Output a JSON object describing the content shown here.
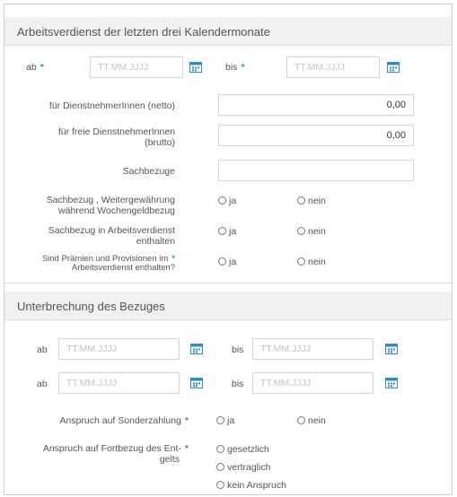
{
  "earnings_section": {
    "title": "Arbeitsverdienst der letzten drei Kalendermonate",
    "from_label": "ab",
    "to_label": "bis",
    "required_mark": "*",
    "date_placeholder": "TT.MM.JJJJ",
    "net_label": "für DienstnehmerInnen (netto)",
    "net_value": "0,00",
    "free_label_line1": "für freie DienstnehmerInnen",
    "free_label_line2": "(brutto)",
    "free_value": "0,00",
    "benefits_label": "Sachbezuge",
    "benefits_value": "",
    "continuation_label_line1": "Sachbezug , Weitergewährung",
    "continuation_label_line2": "während Wochengeldbezug",
    "included_label_line1": "Sachbezug in Arbeitsverdienst",
    "included_label_line2": "enthalten",
    "bonus_label_line1": "Sind Prämien und Provisionen im",
    "bonus_label_line2": "Arbeitsverdienst enthalten?",
    "yes": "ja",
    "no": "nein"
  },
  "interruption_section": {
    "title": "Unterbrechung des Bezuges",
    "from_label": "ab",
    "to_label": "bis",
    "date_placeholder": "TT.MM.JJJJ",
    "special_payment_label": "Anspruch auf Sonderzahlung",
    "continued_pay_label_line1": "Anspruch auf Fortbezug des Ent-",
    "continued_pay_label_line2": "gelts",
    "required_mark": "*",
    "yes": "ja",
    "no": "nein",
    "option_legal": "gesetzlich",
    "option_contractual": "vertraglich",
    "option_none": "kein Anspruch"
  },
  "colors": {
    "accent_green": "#3aa05a",
    "calendar_icon": "#2b8fbf"
  },
  "icons": {
    "date_picker": "calendar-icon"
  }
}
